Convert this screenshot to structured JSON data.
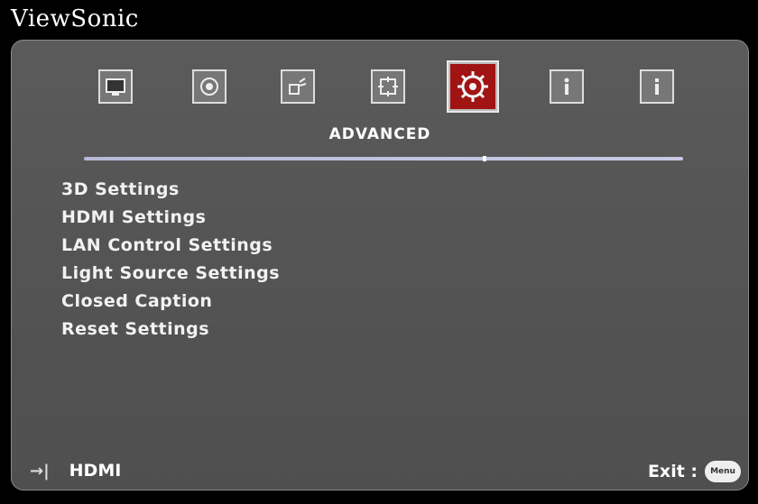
{
  "brand": "ViewSonic",
  "tabs": [
    {
      "icon": "display-icon",
      "active": false
    },
    {
      "icon": "picture-icon",
      "active": false
    },
    {
      "icon": "audio-icon",
      "active": false
    },
    {
      "icon": "basic-icon",
      "active": false
    },
    {
      "icon": "advanced-gear-icon",
      "active": true
    },
    {
      "icon": "information-icon",
      "active": false
    },
    {
      "icon": "info-icon",
      "active": false
    }
  ],
  "active_tab_title": "ADVANCED",
  "menu": [
    "3D Settings",
    "HDMI Settings",
    "LAN Control Settings",
    "Light Source Settings",
    "Closed Caption",
    "Reset Settings"
  ],
  "footer": {
    "source_icon": "input-source-icon",
    "source": "HDMI",
    "exit_label": "Exit :",
    "exit_button": "Menu"
  },
  "colors": {
    "panel": "#555555",
    "active_tab": "#a11414",
    "divider": "#c0c0e0"
  }
}
